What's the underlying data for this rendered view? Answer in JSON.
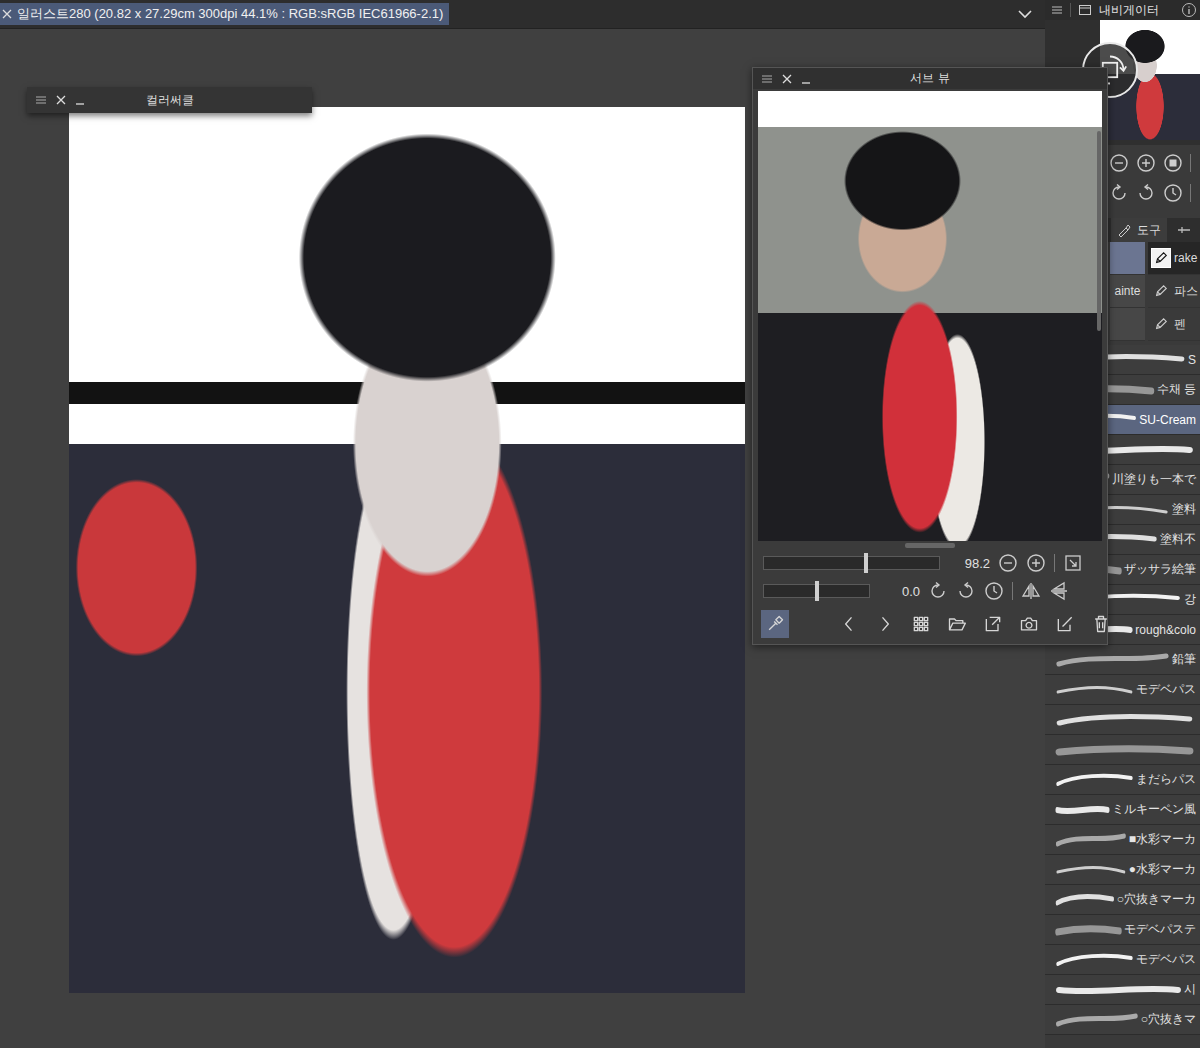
{
  "document_tab": {
    "title": "일러스트280 (20.82 x 27.29cm 300dpi 44.1% : RGB:sRGB IEC61966-2.1)"
  },
  "color_circle_panel": {
    "title": "컬러써클"
  },
  "sub_view": {
    "title": "서브 뷰",
    "zoom": {
      "reading": "98.2",
      "level": 0.58
    },
    "rotation": {
      "reading": "0.0",
      "level": 0.5
    },
    "tools": [
      {
        "selected": true
      },
      {
        "selected": false
      },
      {
        "selected": false
      },
      {
        "selected": false
      },
      {
        "selected": false
      },
      {
        "selected": false
      },
      {
        "selected": false
      },
      {
        "selected": false
      },
      {
        "selected": false
      }
    ]
  },
  "navigator": {
    "title": "내비게이터"
  },
  "tool_tabs": [
    {
      "label": "도구",
      "selected": true
    }
  ],
  "subtool_groups": [
    {
      "label": "",
      "selected": true
    },
    {
      "label": "ainte",
      "selected": false
    },
    {
      "label": "",
      "selected": false
    }
  ],
  "subtools": [
    {
      "label": "rake",
      "selected": true
    },
    {
      "label": "파스",
      "selected": false
    },
    {
      "label": "펜",
      "selected": false
    }
  ],
  "brushes": [
    {
      "label": "S",
      "selected": false
    },
    {
      "label": "수채 등",
      "selected": false
    },
    {
      "label": "SU-Cream",
      "selected": true
    },
    {
      "label": "",
      "selected": false
    },
    {
      "label": "川塗りも一本で",
      "selected": false
    },
    {
      "label": "塗料",
      "selected": false
    },
    {
      "label": "塗料不",
      "selected": false
    },
    {
      "label": "ザッサラ絵筆",
      "selected": false
    },
    {
      "label": "강",
      "selected": false
    },
    {
      "label": "rough&colo",
      "selected": false
    },
    {
      "label": "鉛筆",
      "selected": false
    },
    {
      "label": "モデベパス",
      "selected": false
    },
    {
      "label": "",
      "selected": false
    },
    {
      "label": "",
      "selected": false
    },
    {
      "label": "まだらパス",
      "selected": false
    },
    {
      "label": "ミルキーペン風",
      "selected": false
    },
    {
      "label": "■水彩マーカ",
      "selected": false
    },
    {
      "label": "●水彩マーカ",
      "selected": false
    },
    {
      "label": "○穴抜きマーカ",
      "selected": false
    },
    {
      "label": "モデベパステ",
      "selected": false
    },
    {
      "label": "モデベパス",
      "selected": false
    },
    {
      "label": "시",
      "selected": false
    },
    {
      "label": "○穴抜きマ",
      "selected": false
    }
  ]
}
